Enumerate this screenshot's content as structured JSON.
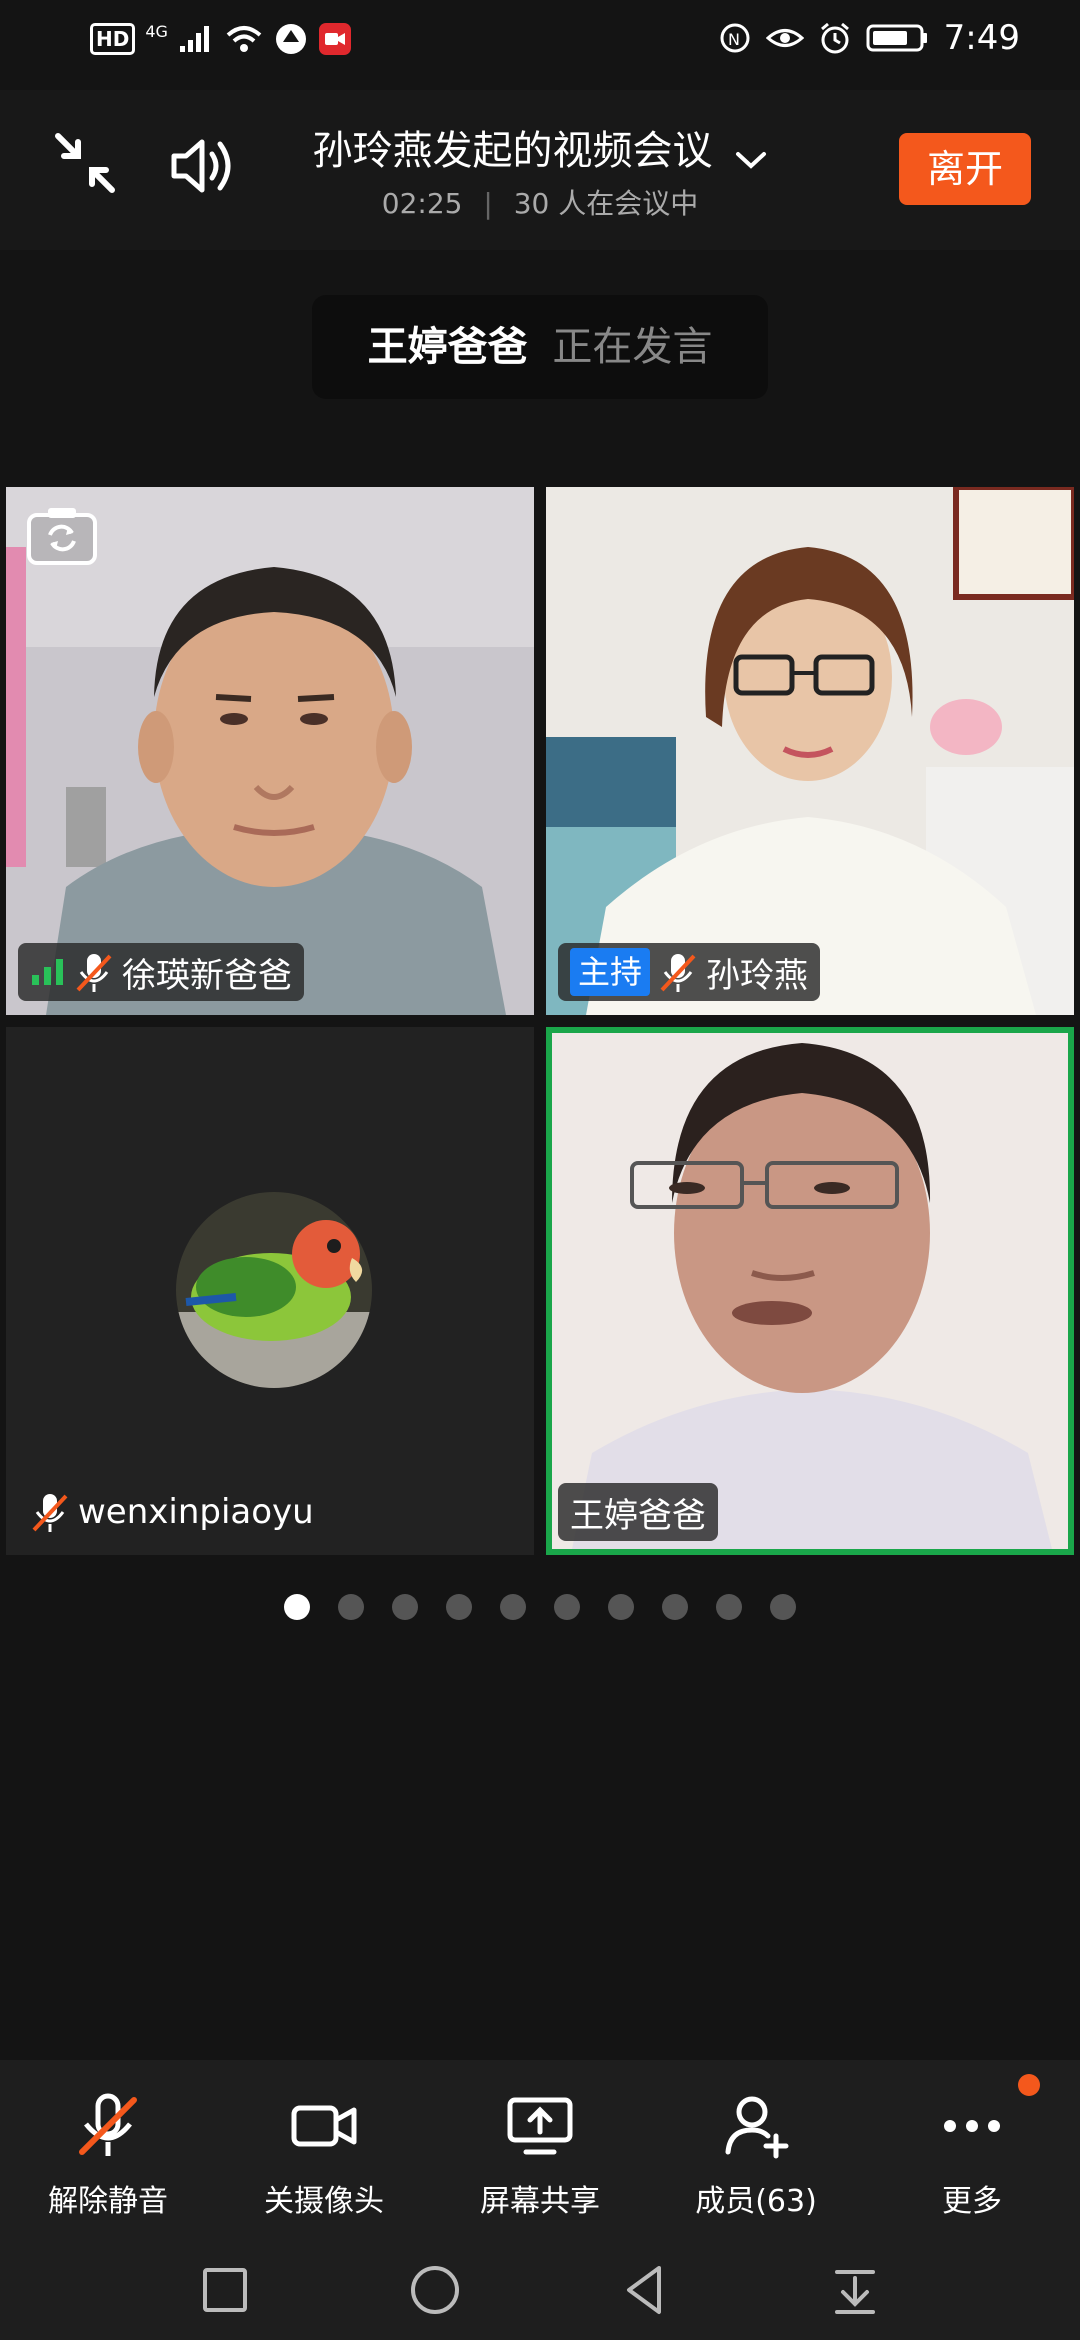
{
  "status_bar": {
    "hd": "HD",
    "network": "4G",
    "time": "7:49",
    "icons": [
      "hd-icon",
      "signal-icon",
      "wifi-icon",
      "app-icon",
      "recording-icon",
      "nfc-icon",
      "eye-icon",
      "alarm-icon",
      "battery-icon"
    ]
  },
  "header": {
    "title": "孙玲燕发起的视频会议",
    "duration": "02:25",
    "participants_text": "30 人在会议中",
    "leave_label": "离开"
  },
  "speaking": {
    "name": "王婷爸爸",
    "status": "正在发言"
  },
  "tiles": [
    {
      "name": "徐瑛新爸爸",
      "muted": true
    },
    {
      "name": "孙玲燕",
      "host_tag": "主持",
      "muted": true
    },
    {
      "name": "wenxinpiaoyu",
      "muted": true
    },
    {
      "name": "王婷爸爸",
      "active_speaker": true
    }
  ],
  "pager": {
    "pages": 10,
    "active": 1
  },
  "toolbar": [
    {
      "label": "解除静音",
      "icon": "mic-off-icon"
    },
    {
      "label": "关摄像头",
      "icon": "camera-icon"
    },
    {
      "label": "屏幕共享",
      "icon": "screen-share-icon"
    },
    {
      "label": "成员(63)",
      "icon": "members-icon"
    },
    {
      "label": "更多",
      "icon": "more-icon"
    }
  ],
  "colors": {
    "accent": "#f4581c",
    "host_tag": "#1a7cf2",
    "speaker_border": "#1aa64a"
  }
}
